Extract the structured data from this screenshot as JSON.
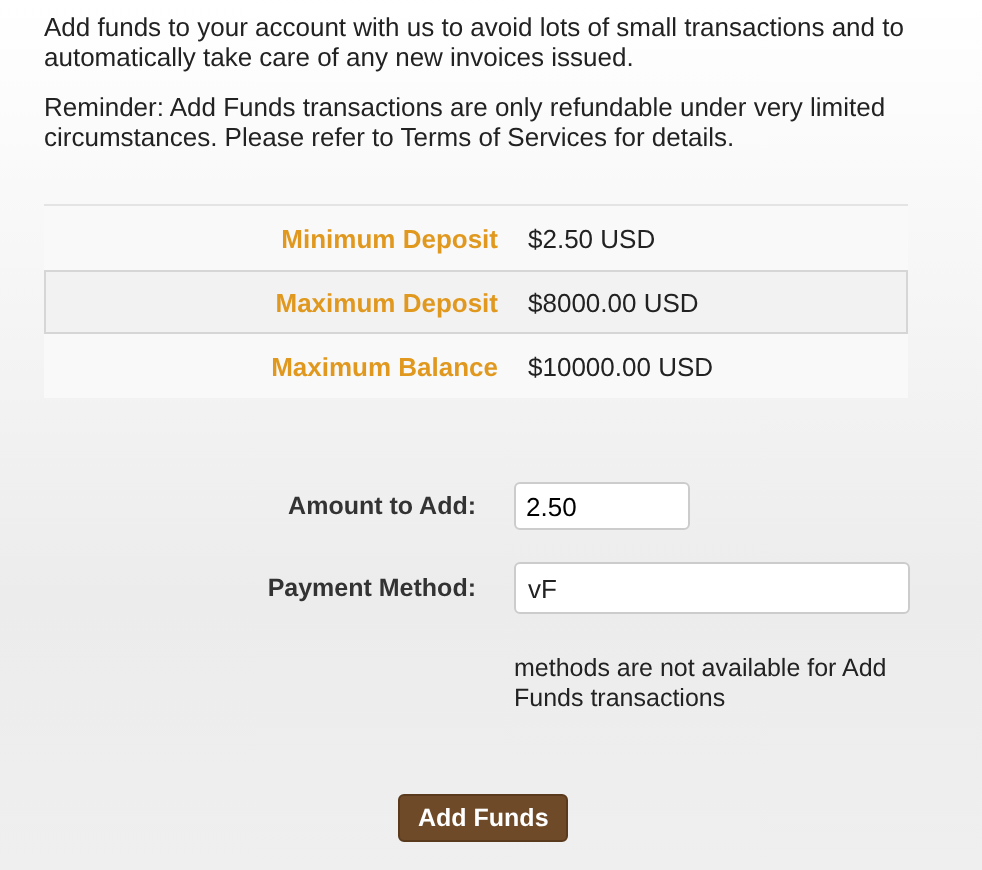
{
  "intro": [
    "Add funds to your account with us to avoid lots of small transactions and to automatically take care of any new invoices issued.",
    "Reminder: Add Funds transactions are only refundable under very limited circumstances. Please refer to Terms of Services for details."
  ],
  "limits": [
    {
      "label": "Minimum Deposit",
      "value": "$2.50 USD"
    },
    {
      "label": "Maximum Deposit",
      "value": "$8000.00 USD"
    },
    {
      "label": "Maximum Balance",
      "value": "$10000.00 USD"
    }
  ],
  "form": {
    "amount": {
      "label": "Amount to Add:",
      "value": "2.50"
    },
    "payment_method": {
      "label": "Payment Method:",
      "value": "vF",
      "note": "methods are not available for Add Funds transactions"
    }
  },
  "submit": "Add Funds"
}
